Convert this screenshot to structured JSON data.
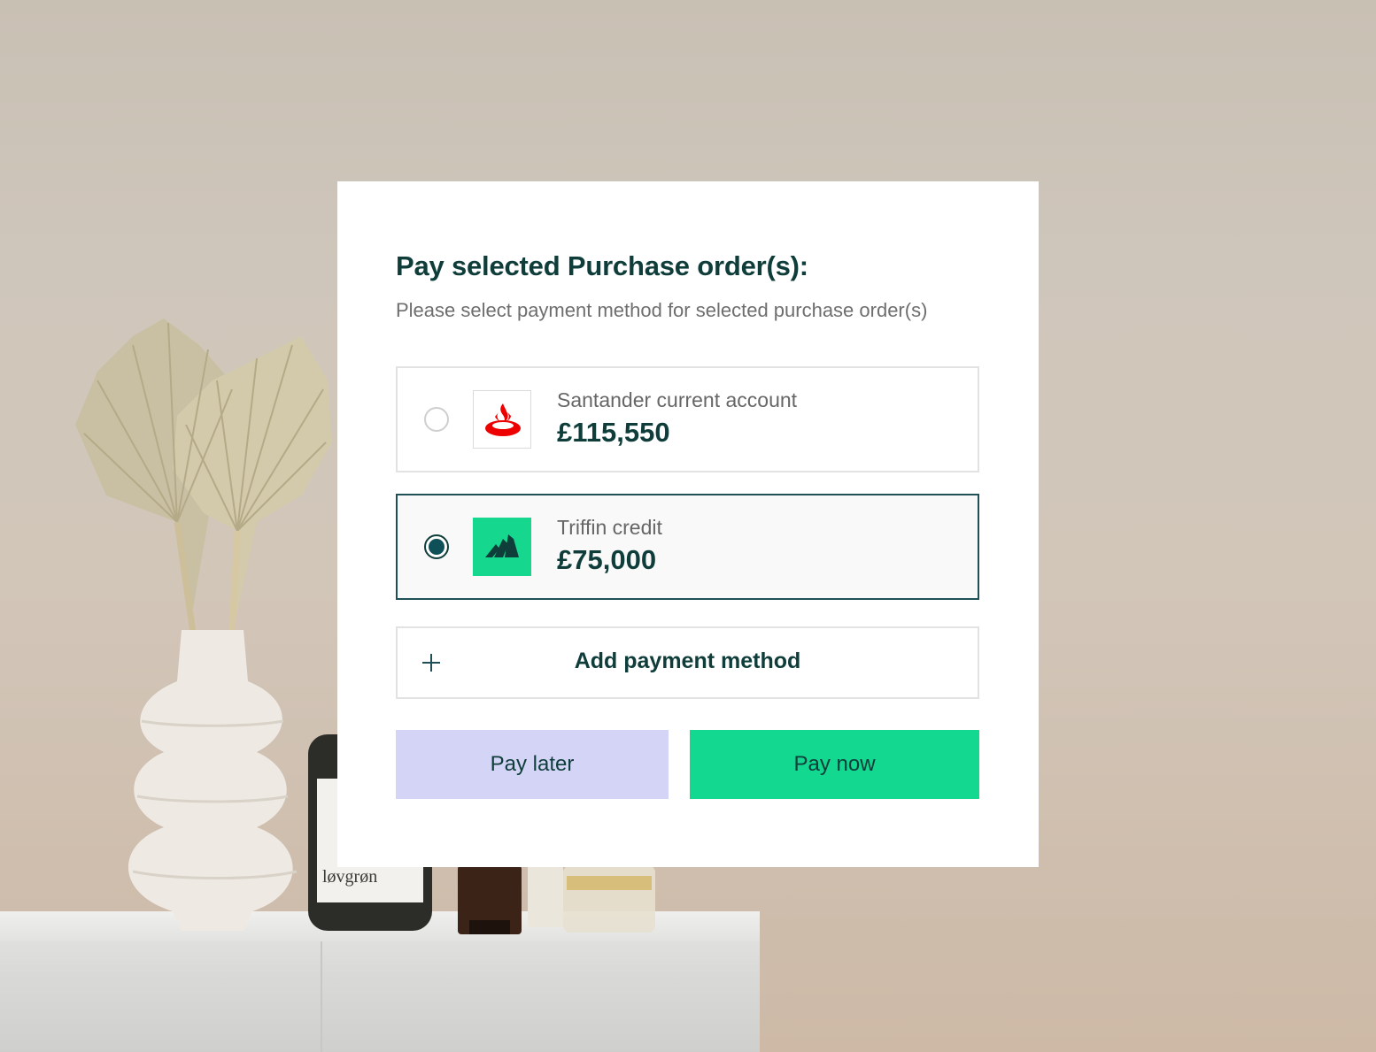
{
  "dialog": {
    "title": "Pay selected Purchase order(s):",
    "subtitle": "Please select payment method for selected purchase order(s)"
  },
  "payment_methods": [
    {
      "name": "Santander current account",
      "amount": "£115,550",
      "logo_icon": "santander-flame-icon",
      "brand_color": "#ec0000",
      "selected": false
    },
    {
      "name": "Triffin credit",
      "amount": "£75,000",
      "logo_icon": "triffin-logo-icon",
      "brand_color": "#15d78e",
      "selected": true
    }
  ],
  "add_method": {
    "label": "Add payment method",
    "icon": "plus-icon"
  },
  "buttons": {
    "pay_later": "Pay later",
    "pay_now": "Pay now"
  },
  "background_labels": {
    "bottle_brand": "løvgrøn"
  },
  "colors": {
    "primary_text": "#0f3d3a",
    "pay_now_bg": "#13d88f",
    "pay_later_bg": "#d4d4f7",
    "selected_border": "#1f5055"
  }
}
